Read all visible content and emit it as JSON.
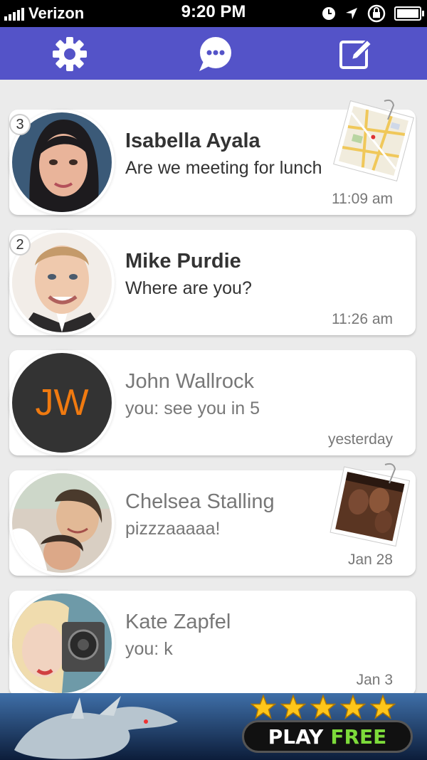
{
  "status_bar": {
    "carrier": "Verizon",
    "time": "9:20 PM"
  },
  "nav": {
    "left_icon": "gear-icon",
    "center_icon": "chat-bubble-icon",
    "right_icon": "compose-icon",
    "background": "#5453c8"
  },
  "conversations": [
    {
      "badge": "3",
      "name": "Isabella Ayala",
      "preview": "Are we meeting for lunch",
      "time": "11:09 am",
      "unread": true,
      "attachment": "map-thumbnail"
    },
    {
      "badge": "2",
      "name": "Mike Purdie",
      "preview": "Where are you?",
      "time": "11:26 am",
      "unread": true
    },
    {
      "name": "John Wallrock",
      "initials": "JW",
      "preview": "you: see you in 5",
      "time": "yesterday",
      "unread": false
    },
    {
      "name": "Chelsea Stalling",
      "preview": "pizzzaaaaa!",
      "time": "Jan 28",
      "unread": false,
      "attachment": "photo-thumbnail"
    },
    {
      "name": "Kate Zapfel",
      "preview": "you: k",
      "time": "Jan 3",
      "unread": false
    }
  ],
  "ad": {
    "button_word_1": "PLAY",
    "button_word_2": "FREE",
    "stars": 5
  },
  "colors": {
    "accent": "#5453c8",
    "initials_text": "#f07a10",
    "initials_bg": "#333333"
  }
}
